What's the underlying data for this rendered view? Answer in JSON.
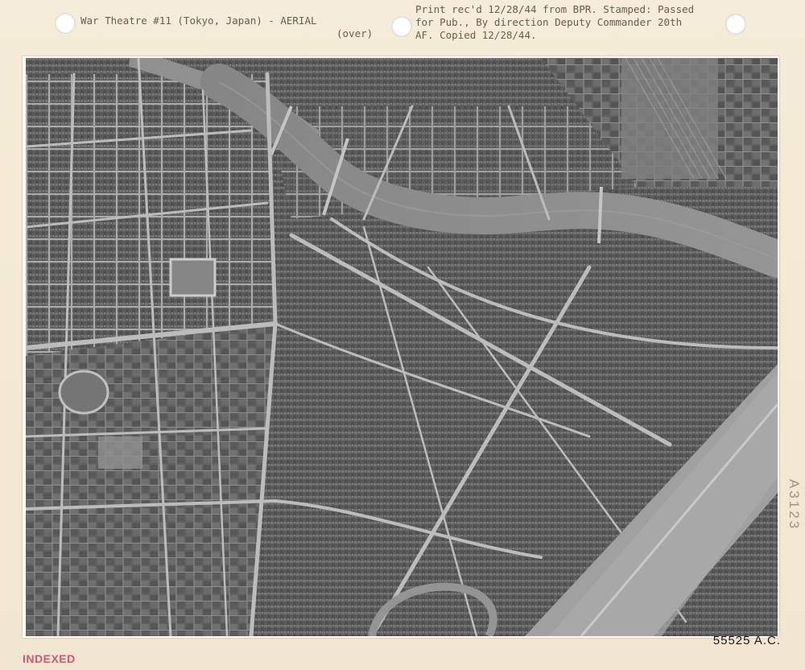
{
  "caption": {
    "left_line1": "War Theatre #11 (Tokyo, Japan) - AERIAL",
    "left_line2": "(over)",
    "right_line1": "Print rec'd 12/28/44 from BPR. Stamped: Passed",
    "right_line2": "for Pub., By direction Deputy Commander 20th",
    "right_line3": "AF. Copied 12/28/44."
  },
  "photo_number": "55525  A.C.",
  "stamp_text": "INDEXED",
  "side_note": "A3123",
  "colors": {
    "paper": "#f3ead7",
    "caption_ink": "#6a5e4a",
    "stamp_ink": "#c8406a",
    "river": "#8c8c8c",
    "city": "#5c5c5c",
    "streets": "#b8b8b8"
  },
  "photo_subject": "aerial-photograph-city-river"
}
